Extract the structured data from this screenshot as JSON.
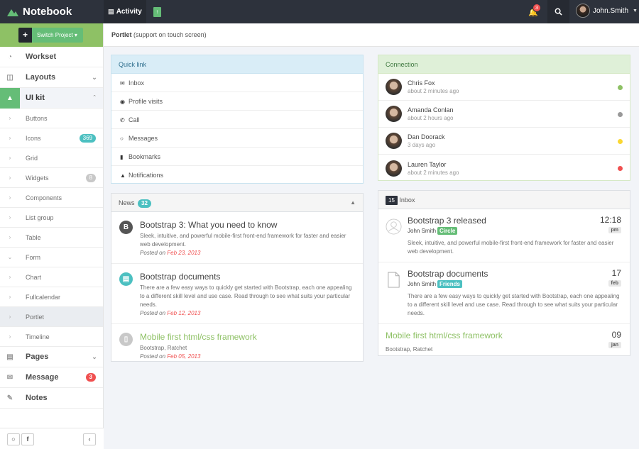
{
  "brand": {
    "name": "Notebook"
  },
  "topbar": {
    "activity_label": "Activity",
    "notification_count": "3",
    "user_name": "John.Smith"
  },
  "sidebar": {
    "switch_label": "Switch Project",
    "message_badge": "3",
    "items": [
      {
        "label": "Workset"
      },
      {
        "label": "Layouts"
      },
      {
        "label": "UI kit"
      },
      {
        "label": "Pages"
      },
      {
        "label": "Message"
      },
      {
        "label": "Notes"
      }
    ],
    "subitems": [
      {
        "label": "Buttons"
      },
      {
        "label": "Icons",
        "badge": "369"
      },
      {
        "label": "Grid"
      },
      {
        "label": "Widgets",
        "badge": "8"
      },
      {
        "label": "Components"
      },
      {
        "label": "List group"
      },
      {
        "label": "Table"
      },
      {
        "label": "Form"
      },
      {
        "label": "Chart"
      },
      {
        "label": "Fullcalendar"
      },
      {
        "label": "Portlet"
      },
      {
        "label": "Timeline"
      }
    ]
  },
  "header": {
    "title": "Portlet",
    "subtitle": "(support on touch screen)"
  },
  "quicklink": {
    "title": "Quick link",
    "items": [
      {
        "label": "Inbox",
        "icon": "envelope-icon"
      },
      {
        "label": "Profile visits",
        "icon": "eye-icon"
      },
      {
        "label": "Call",
        "icon": "phone-icon"
      },
      {
        "label": "Messages",
        "icon": "comments-icon"
      },
      {
        "label": "Bookmarks",
        "icon": "bookmark-icon"
      },
      {
        "label": "Notifications",
        "icon": "bell-icon"
      }
    ]
  },
  "news": {
    "title": "News",
    "count": "32",
    "items": [
      {
        "title": "Bootstrap 3: What you need to know",
        "body": "Sleek, intuitive, and powerful mobile-first front-end framework for faster and easier web development.",
        "posted": "Posted on",
        "date": "Feb 23, 2013"
      },
      {
        "title": "Bootstrap documents",
        "body": "There are a few easy ways to quickly get started with Bootstrap, each one appealing to a different skill level and use case. Read through to see what suits your particular needs.",
        "posted": "Posted on",
        "date": "Feb 12, 2013"
      },
      {
        "title": "Mobile first html/css framework",
        "body": "Bootstrap, Ratchet",
        "posted": "Posted on",
        "date": "Feb 05, 2013"
      }
    ]
  },
  "connection": {
    "title": "Connection",
    "people": [
      {
        "name": "Chris Fox",
        "time": "about 2 minutes ago",
        "status_color": "#8ec165"
      },
      {
        "name": "Amanda Conlan",
        "time": "about 2 hours ago",
        "status_color": "#999999"
      },
      {
        "name": "Dan Doorack",
        "time": "3 days ago",
        "status_color": "#fad733"
      },
      {
        "name": "Lauren Taylor",
        "time": "about 2 minutes ago",
        "status_color": "#f05050"
      }
    ]
  },
  "inbox": {
    "title": "Inbox",
    "count": "15",
    "items": [
      {
        "title": "Bootstrap 3 released",
        "author": "John Smith",
        "tag": "Circle",
        "body": "Sleek, intuitive, and powerful mobile-first front-end framework for faster and easier web development.",
        "date_big": "12:18",
        "date_small": "pm"
      },
      {
        "title": "Bootstrap documents",
        "author": "John Smith",
        "tag": "Friends",
        "body": "There are a few easy ways to quickly get started with Bootstrap, each one appealing to a different skill level and use case. Read through to see what suits your particular needs.",
        "date_big": "17",
        "date_small": "feb"
      },
      {
        "title": "Mobile first html/css framework",
        "body": "Bootstrap, Ratchet",
        "date_big": "09",
        "date_small": "jan"
      }
    ]
  },
  "colors": {
    "green": "#8ec165",
    "success": "#65bd77",
    "info": "#4cc0c1",
    "danger": "#f05050",
    "dark": "#2d323c"
  }
}
